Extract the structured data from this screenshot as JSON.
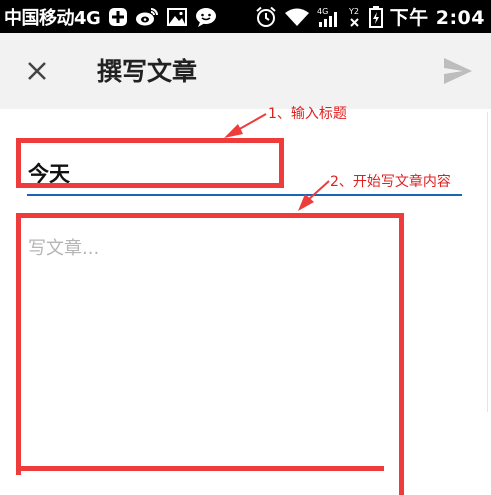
{
  "status_bar": {
    "carrier": "中国移动4G",
    "signal_4g_label": "4G",
    "time_prefix": "下午",
    "time": "2:04",
    "icons": [
      "plus-badge-icon",
      "weibo-icon",
      "image-icon",
      "chat-bubble-icon",
      "alarm-icon",
      "wifi-icon",
      "signal-4g-icon",
      "signal-secondary-icon",
      "battery-icon"
    ]
  },
  "app_bar": {
    "title": "撰写文章",
    "close_icon": "close-icon",
    "send_icon": "send-icon"
  },
  "editor": {
    "title_value": "今天",
    "body_placeholder": "写文章...",
    "underline_color": "#1a64b5"
  },
  "annotations": {
    "note1": "1、输入标题",
    "note2": "2、开始写文章内容",
    "color": "#ee3b3b"
  }
}
